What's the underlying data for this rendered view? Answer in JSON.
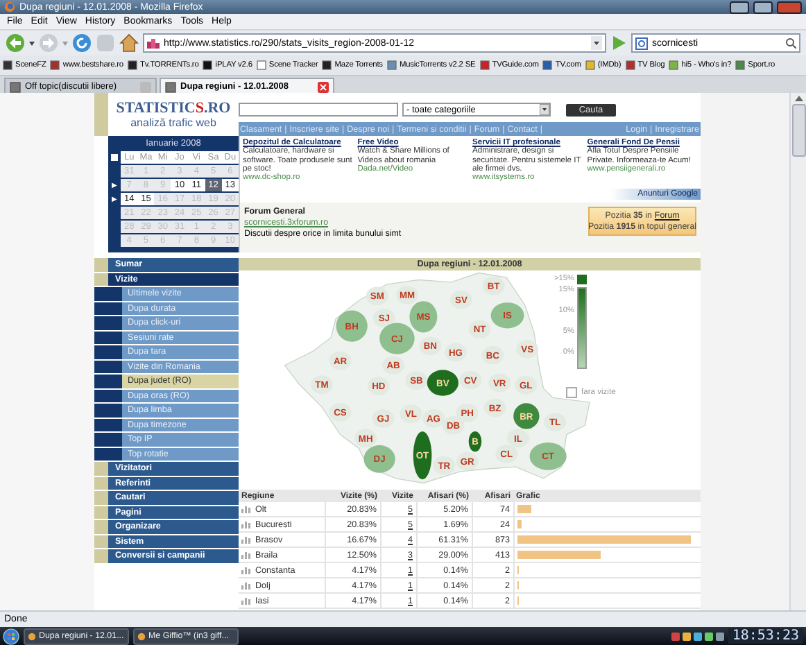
{
  "window": {
    "title": "Dupa regiuni - 12.01.2008 - Mozilla Firefox"
  },
  "menu": [
    "File",
    "Edit",
    "View",
    "History",
    "Bookmarks",
    "Tools",
    "Help"
  ],
  "address": {
    "value": "http://www.statistics.ro/290/stats_visits_region-2008-01-12"
  },
  "web_search": {
    "value": "scornicesti"
  },
  "bookmarks": [
    "SceneFZ",
    "www.bestshare.ro",
    "Tv.TORRENTs.ro",
    "iPLAY v2.6",
    "Scene Tracker",
    "Maze Torrents",
    "MusicTorrents v2.2 SE",
    "TVGuide.com",
    "TV.com",
    "(IMDb)",
    "TV Blog",
    "hi5 - Who's in?",
    "Sport.ro"
  ],
  "tabs": [
    {
      "label": "Off topic(discutii libere)",
      "selected": false
    },
    {
      "label": "Dupa regiuni - 12.01.2008",
      "selected": true
    }
  ],
  "site": {
    "logo": {
      "parts": [
        "STATISTIC",
        "S",
        ".RO"
      ],
      "tagline": "analiză trafic web"
    },
    "category_select": "- toate categoriile",
    "search_button": "Cauta",
    "nav_links": [
      "Clasament",
      "Inscriere site",
      "Despre noi",
      "Termeni si conditii",
      "Forum",
      "Contact"
    ],
    "nav_separator": "|",
    "account_links": [
      "Login",
      "Inregistrare"
    ],
    "calendar": {
      "month": "Ianuarie 2008",
      "weekdays": [
        "Lu",
        "Ma",
        "Mi",
        "Jo",
        "Vi",
        "Sa",
        "Du"
      ],
      "weeks": [
        {
          "days": [
            {
              "day": "31",
              "active": false,
              "selected": false
            },
            {
              "day": "1",
              "active": false,
              "selected": false
            },
            {
              "day": "2",
              "active": false,
              "selected": false
            },
            {
              "day": "3",
              "active": false,
              "selected": false
            },
            {
              "day": "4",
              "active": false,
              "selected": false
            },
            {
              "day": "5",
              "active": false,
              "selected": false
            },
            {
              "day": "6",
              "active": false,
              "selected": false
            }
          ]
        },
        {
          "marker": "▶",
          "days": [
            {
              "day": "7",
              "active": false,
              "selected": false
            },
            {
              "day": "8",
              "active": false,
              "selected": false
            },
            {
              "day": "9",
              "active": false,
              "selected": false
            },
            {
              "day": "10",
              "active": true,
              "selected": false
            },
            {
              "day": "11",
              "active": true,
              "selected": false
            },
            {
              "day": "12",
              "active": true,
              "selected": true
            },
            {
              "day": "13",
              "active": true,
              "selected": false
            }
          ]
        },
        {
          "marker": "▶",
          "days": [
            {
              "day": "14",
              "active": true,
              "selected": false
            },
            {
              "day": "15",
              "active": true,
              "selected": false
            },
            {
              "day": "16",
              "active": false,
              "selected": false
            },
            {
              "day": "17",
              "active": false,
              "selected": false
            },
            {
              "day": "18",
              "active": false,
              "selected": false
            },
            {
              "day": "19",
              "active": false,
              "selected": false
            },
            {
              "day": "20",
              "active": false,
              "selected": false
            }
          ]
        },
        {
          "days": [
            {
              "day": "21",
              "active": false,
              "selected": false
            },
            {
              "day": "22",
              "active": false,
              "selected": false
            },
            {
              "day": "23",
              "active": false,
              "selected": false
            },
            {
              "day": "24",
              "active": false,
              "selected": false
            },
            {
              "day": "25",
              "active": false,
              "selected": false
            },
            {
              "day": "26",
              "active": false,
              "selected": false
            },
            {
              "day": "27",
              "active": false,
              "selected": false
            }
          ]
        },
        {
          "days": [
            {
              "day": "28",
              "active": false,
              "selected": false
            },
            {
              "day": "29",
              "active": false,
              "selected": false
            },
            {
              "day": "30",
              "active": false,
              "selected": false
            },
            {
              "day": "31",
              "active": false,
              "selected": false
            },
            {
              "day": "1",
              "active": false,
              "selected": false
            },
            {
              "day": "2",
              "active": false,
              "selected": false
            },
            {
              "day": "3",
              "active": false,
              "selected": false
            }
          ]
        },
        {
          "days": [
            {
              "day": "4",
              "active": false,
              "selected": false
            },
            {
              "day": "5",
              "active": false,
              "selected": false
            },
            {
              "day": "6",
              "active": false,
              "selected": false
            },
            {
              "day": "7",
              "active": false,
              "selected": false
            },
            {
              "day": "8",
              "active": false,
              "selected": false
            },
            {
              "day": "9",
              "active": false,
              "selected": false
            },
            {
              "day": "10",
              "active": false,
              "selected": false
            }
          ]
        }
      ]
    },
    "ads": [
      {
        "title": "Depozitul de Calculatoare",
        "text": "Calculatoare, hardware si software. Toate produsele sunt pe stoc!",
        "url": "www.dc-shop.ro"
      },
      {
        "title": "Free Video",
        "text": "Watch & Share Millions of Videos about romania",
        "url": "Dada.net/Video"
      },
      {
        "title": "Servicii IT profesionale",
        "text": "Administrare, design si securitate. Pentru sistemele IT ale firmei dvs.",
        "url": "www.itsystems.ro"
      },
      {
        "title": "Generali Fond De Pensii",
        "text": "Afla Totul Despre Pensiile Private. Informeaza-te Acum!",
        "url": "www.pensiigenerali.ro"
      }
    ],
    "ads_by": "Anunturi Google",
    "forum": {
      "title": "Forum General",
      "link": "scornicesti.3xforum.ro",
      "description": "Discutii despre orice in limita bunului simt"
    },
    "rank": [
      {
        "text": "Pozitia **35** in",
        "link": "Forum"
      },
      {
        "text": "Pozitia **1915** in topul general"
      }
    ],
    "sidebar": [
      {
        "label": "Sumar",
        "expanded": false
      },
      {
        "label": "Vizite",
        "expanded": true,
        "children": [
          {
            "label": "Ultimele vizite",
            "selected": false
          },
          {
            "label": "Dupa durata",
            "selected": false
          },
          {
            "label": "Dupa click-uri",
            "selected": false
          },
          {
            "label": "Sesiuni rate",
            "selected": false
          },
          {
            "label": "Dupa tara",
            "selected": false
          },
          {
            "label": "Vizite din Romania",
            "selected": false
          },
          {
            "label": "Dupa judet (RO)",
            "selected": true
          },
          {
            "label": "Dupa oras (RO)",
            "selected": false
          },
          {
            "label": "Dupa limba",
            "selected": false
          },
          {
            "label": "Dupa timezone",
            "selected": false
          },
          {
            "label": "Top IP",
            "selected": false
          },
          {
            "label": "Top rotatie",
            "selected": false
          }
        ]
      },
      {
        "label": "Vizitatori",
        "expanded": false
      },
      {
        "label": "Referinti",
        "expanded": false
      },
      {
        "label": "Cautari",
        "expanded": false
      },
      {
        "label": "Pagini",
        "expanded": false
      },
      {
        "label": "Organizare",
        "expanded": false
      },
      {
        "label": "Sistem",
        "expanded": false
      },
      {
        "label": "Conversii si campanii",
        "expanded": false
      }
    ],
    "map": {
      "title": "Dupa regiuni - 12.01.2008",
      "counties": [
        {
          "code": "SM",
          "color": "#e2eae2"
        },
        {
          "code": "MM",
          "color": "#e2eae2"
        },
        {
          "code": "SV",
          "color": "#e2eae2"
        },
        {
          "code": "BT",
          "color": "#e2eae2"
        },
        {
          "code": "BH",
          "color": "#8fbf8f"
        },
        {
          "code": "SJ",
          "color": "#e2eae2"
        },
        {
          "code": "MS",
          "color": "#8fbf8f"
        },
        {
          "code": "NT",
          "color": "#e2eae2"
        },
        {
          "code": "IS",
          "color": "#8fbf8f"
        },
        {
          "code": "CJ",
          "color": "#8fbf8f"
        },
        {
          "code": "BN",
          "color": "#e2eae2"
        },
        {
          "code": "HG",
          "color": "#e2eae2"
        },
        {
          "code": "BC",
          "color": "#e2eae2"
        },
        {
          "code": "VS",
          "color": "#e2eae2"
        },
        {
          "code": "AR",
          "color": "#e2eae2"
        },
        {
          "code": "AB",
          "color": "#e2eae2"
        },
        {
          "code": "TM",
          "color": "#e2eae2"
        },
        {
          "code": "HD",
          "color": "#e2eae2"
        },
        {
          "code": "SB",
          "color": "#e2eae2"
        },
        {
          "code": "BV",
          "color": "#1f6e1f"
        },
        {
          "code": "CV",
          "color": "#e2eae2"
        },
        {
          "code": "VR",
          "color": "#e2eae2"
        },
        {
          "code": "GL",
          "color": "#e2eae2"
        },
        {
          "code": "CS",
          "color": "#e2eae2"
        },
        {
          "code": "GJ",
          "color": "#e2eae2"
        },
        {
          "code": "VL",
          "color": "#e2eae2"
        },
        {
          "code": "AG",
          "color": "#e2eae2"
        },
        {
          "code": "DB",
          "color": "#e2eae2"
        },
        {
          "code": "PH",
          "color": "#e2eae2"
        },
        {
          "code": "BZ",
          "color": "#e2eae2"
        },
        {
          "code": "BR",
          "color": "#3f8a3f"
        },
        {
          "code": "TL",
          "color": "#e2eae2"
        },
        {
          "code": "MH",
          "color": "#e2eae2"
        },
        {
          "code": "B",
          "color": "#1f6e1f"
        },
        {
          "code": "IL",
          "color": "#e2eae2"
        },
        {
          "code": "DJ",
          "color": "#8fbf8f"
        },
        {
          "code": "OT",
          "color": "#1f6e1f"
        },
        {
          "code": "TR",
          "color": "#e2eae2"
        },
        {
          "code": "GR",
          "color": "#e2eae2"
        },
        {
          "code": "CL",
          "color": "#e2eae2"
        },
        {
          "code": "CT",
          "color": "#8fbf8f"
        }
      ],
      "legend": [
        ">15%",
        "15%",
        "10%",
        "5%",
        "0%"
      ],
      "no_visits": "fara vizite"
    },
    "table": {
      "columns": [
        "Regiune",
        "Vizite (%)",
        "Vizite",
        "Afisari (%)",
        "Afisari",
        "Grafic"
      ],
      "rows": [
        {
          "region": "Olt",
          "visits_pct": "20.83%",
          "visits": "5",
          "views_pct": "5.20%",
          "views": "74",
          "level": 0.07
        },
        {
          "region": "Bucuresti",
          "visits_pct": "20.83%",
          "visits": "5",
          "views_pct": "1.69%",
          "views": "24",
          "level": 0.026
        },
        {
          "region": "Brasov",
          "visits_pct": "16.67%",
          "visits": "4",
          "views_pct": "61.31%",
          "views": "873",
          "level": 0.83
        },
        {
          "region": "Braila",
          "visits_pct": "12.50%",
          "visits": "3",
          "views_pct": "29.00%",
          "views": "413",
          "level": 0.4
        },
        {
          "region": "Constanta",
          "visits_pct": "4.17%",
          "visits": "1",
          "views_pct": "0.14%",
          "views": "2",
          "level": 0.007
        },
        {
          "region": "Dolj",
          "visits_pct": "4.17%",
          "visits": "1",
          "views_pct": "0.14%",
          "views": "2",
          "level": 0.007
        },
        {
          "region": "Iasi",
          "visits_pct": "4.17%",
          "visits": "1",
          "views_pct": "0.14%",
          "views": "2",
          "level": 0.007
        }
      ]
    }
  },
  "status_bar": "Done",
  "taskbar": {
    "buttons": [
      "Dupa regiuni - 12.01...",
      "Me Giffio™ (in3 giff..."
    ],
    "clock": "18:53:23"
  }
}
